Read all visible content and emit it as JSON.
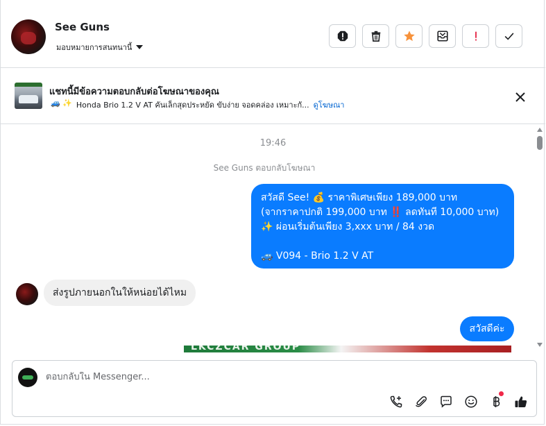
{
  "header": {
    "contact_name": "See Guns",
    "assign_label": "มอบหมายการสนทนานี้",
    "actions": [
      {
        "name": "report-icon",
        "label": "!"
      },
      {
        "name": "trash-icon"
      },
      {
        "name": "star-icon",
        "color": "#f7923b"
      },
      {
        "name": "archive-icon"
      },
      {
        "name": "important-icon",
        "label": "!"
      },
      {
        "name": "check-icon"
      }
    ]
  },
  "ad": {
    "title": "แชทนี้มีข้อความตอบกลับต่อโฆษณาของคุณ",
    "emoji": "🚙 ✨",
    "description": "Honda Brio 1.2 V AT คันเล็กสุดประหยัด ขับง่าย จอดคล่อง เหมาะกั...",
    "link": "ดูโฆษณา"
  },
  "conversation": {
    "time": "19:46",
    "replied_note": "See Guns ตอบกลับโฆษณา",
    "outgoing_lines": [
      "สวัสดี See! 💰 ราคาพิเศษเพียง 189,000 บาท",
      "(จากราคาปกติ 199,000 บาท ‼️ ลดทันที 10,000 บาท)",
      "✨ ผ่อนเริ่มต้นเพียง 3,xxx บาท / 84 งวด",
      "",
      "🚙 V094 - Brio 1.2 V AT"
    ],
    "incoming": "ส่งรูปภายนอกในให้หน่อยได้ไหม",
    "outgoing_short": "สวัสดีค่ะ",
    "image_peek_text": "LKCZCAR GROUP"
  },
  "composer": {
    "placeholder": "ตอบกลับใน Messenger...",
    "tools": [
      "call-add-icon",
      "attachment-icon",
      "saved-reply-icon",
      "emoji-icon",
      "baht-payment-icon",
      "thumbs-up-icon"
    ]
  },
  "colors": {
    "accent": "#0a7cff",
    "link": "#0064d1",
    "star": "#f7923b",
    "important": "#e41e3f",
    "notification_dot": "#f02849"
  }
}
